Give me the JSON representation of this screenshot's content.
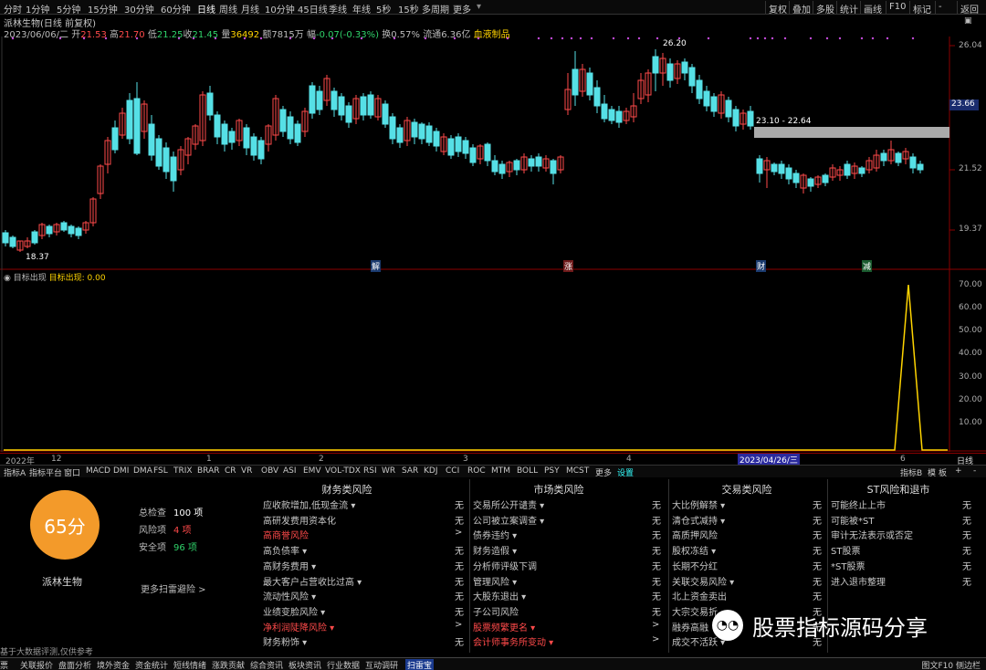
{
  "toolbar": {
    "timeframes": [
      "分时",
      "1分钟",
      "5分钟",
      "15分钟",
      "30分钟",
      "60分钟",
      "日线",
      "周线",
      "月线",
      "10分钟",
      "45日线",
      "季线",
      "年线",
      "5秒",
      "15秒",
      "多周期",
      "更多"
    ],
    "right_buttons": [
      "复权",
      "叠加",
      "多股",
      "统计",
      "画线",
      "F10",
      "标记",
      "-",
      "返回"
    ]
  },
  "stock": {
    "title": "派林生物(日线 前复权)",
    "date": "2023/06/06/二",
    "open_label": "开",
    "open": "21.53",
    "high_label": "高",
    "high": "21.70",
    "low_label": "低",
    "low": "21.25",
    "close_label": "收",
    "close": "21.45",
    "volume_label": "量",
    "volume": "36492",
    "amount_label": "额",
    "amount": "7815万",
    "change_label": "幅",
    "change": "-0.07(-0.33%)",
    "turnover_label": "换",
    "turnover": "0.57%",
    "float_label": "流通",
    "float": "6.36亿",
    "sector": "血液制品"
  },
  "price_axis": [
    "26.04",
    "23.66",
    "21.52",
    "19.37"
  ],
  "price_highlight": "23.66",
  "annotations": {
    "high": "26.20",
    "low": "18.37",
    "range": "23.10 - 22.64"
  },
  "event_markers": [
    "解",
    "涨",
    "财",
    "减"
  ],
  "indicator": {
    "name": "目标出现",
    "label": "目标出现:",
    "value": "0.00",
    "axis": [
      "70.00",
      "60.00",
      "50.00",
      "40.00",
      "30.00",
      "20.00",
      "10.00"
    ]
  },
  "date_axis": {
    "labels": [
      "2022年",
      "12",
      "1",
      "2",
      "3",
      "4",
      "6"
    ],
    "highlight": "2023/04/26/三",
    "right_label": "日线"
  },
  "indicator_tabs": [
    "指标A",
    "指标平台",
    "窗口",
    "MACD",
    "DMI",
    "DMA",
    "FSL",
    "TRIX",
    "BRAR",
    "CR",
    "VR",
    "OBV",
    "ASI",
    "EMV",
    "VOL-TDX",
    "RSI",
    "WR",
    "SAR",
    "KDJ",
    "CCI",
    "ROC",
    "MTM",
    "BOLL",
    "PSY",
    "MCST",
    "更多",
    "设置"
  ],
  "indicator_tabs_right": [
    "指标B",
    "模",
    "板",
    "+",
    "-"
  ],
  "risk": {
    "score": "65分",
    "name": "派林生物",
    "total_label": "总检查",
    "total": "100 项",
    "risk_label": "风险项",
    "risk_count": "4 项",
    "safe_label": "安全项",
    "safe_count": "96 项",
    "more": "更多扫雷避险 >",
    "footnote": "基于大数据评测,仅供参考",
    "columns": [
      {
        "title": "财务类风险",
        "items": [
          [
            "应收款增加,低现金流 ▾",
            "无"
          ],
          [
            "高研发费用资本化",
            "无"
          ],
          [
            "高商誉风险",
            ">"
          ],
          [
            "高负债率 ▾",
            "无"
          ],
          [
            "高财务费用 ▾",
            "无"
          ],
          [
            "最大客户占营收比过高 ▾",
            "无"
          ],
          [
            "流动性风险 ▾",
            "无"
          ],
          [
            "业绩变脸风险 ▾",
            "无"
          ],
          [
            "净利润陡降风险 ▾",
            ">"
          ],
          [
            "财务粉饰 ▾",
            "无"
          ]
        ],
        "flags": [
          false,
          false,
          true,
          false,
          false,
          false,
          false,
          false,
          true,
          false
        ]
      },
      {
        "title": "市场类风险",
        "items": [
          [
            "交易所公开谴责 ▾",
            "无"
          ],
          [
            "公司被立案调查 ▾",
            "无"
          ],
          [
            "债券违约 ▾",
            "无"
          ],
          [
            "财务造假 ▾",
            "无"
          ],
          [
            "分析师评级下调",
            "无"
          ],
          [
            "管理风险 ▾",
            "无"
          ],
          [
            "大股东退出 ▾",
            "无"
          ],
          [
            "子公司风险",
            "无"
          ],
          [
            "股票频繁更名 ▾",
            ">"
          ],
          [
            "会计师事务所变动 ▾",
            ">"
          ]
        ],
        "flags": [
          false,
          false,
          false,
          false,
          false,
          false,
          false,
          false,
          true,
          true
        ]
      },
      {
        "title": "交易类风险",
        "items": [
          [
            "大比例解禁 ▾",
            "无"
          ],
          [
            "清仓式减持 ▾",
            "无"
          ],
          [
            "高质押风险",
            "无"
          ],
          [
            "股权冻结 ▾",
            "无"
          ],
          [
            "长期不分红",
            "无"
          ],
          [
            "关联交易风险 ▾",
            "无"
          ],
          [
            "北上资金卖出",
            "无"
          ],
          [
            "大宗交易折",
            "无"
          ],
          [
            "融券高融",
            "无"
          ],
          [
            "成交不活跃 ▾",
            "无"
          ]
        ],
        "flags": [
          false,
          false,
          false,
          false,
          false,
          false,
          false,
          false,
          false,
          false
        ]
      },
      {
        "title": "ST风险和退市",
        "items": [
          [
            "可能终止上市",
            "无"
          ],
          [
            "可能被*ST",
            "无"
          ],
          [
            "审计无法表示或否定",
            "无"
          ],
          [
            "ST股票",
            "无"
          ],
          [
            "*ST股票",
            "无"
          ],
          [
            "进入退市整理",
            "无"
          ]
        ],
        "flags": [
          false,
          false,
          false,
          false,
          false,
          false
        ]
      }
    ]
  },
  "watermark": "股票指标源码分享",
  "bottom_tabs": [
    "票",
    "关联报价",
    "盘面分析",
    "境外资金",
    "资金统计",
    "短线情绪",
    "涨跌贡献",
    "综合资讯",
    "板块资讯",
    "行业数据",
    "互动调研",
    "扫雷宝"
  ],
  "bottom_right": "图文F10 侧边栏"
}
